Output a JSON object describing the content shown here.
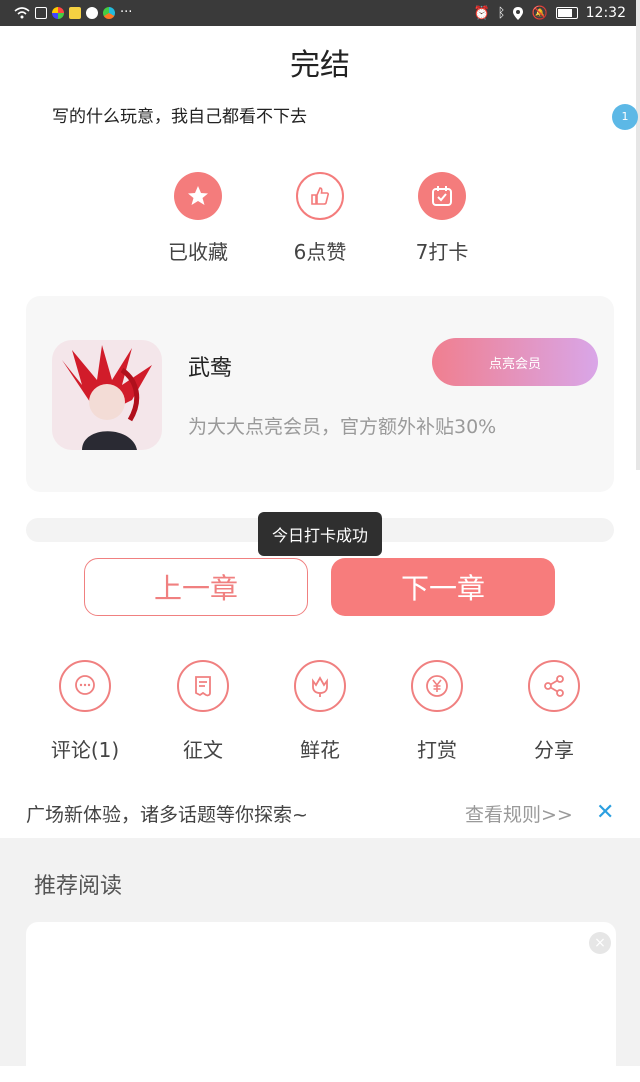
{
  "status_bar": {
    "time": "12:32",
    "left_icons": [
      "wifi-icon",
      "cloud-icon",
      "app-icon",
      "app-icon",
      "chat-icon",
      "app-icon"
    ],
    "more_indicator": "···"
  },
  "header": {
    "title": "完结"
  },
  "comment": {
    "text": "写的什么玩意，我自己都看不下去"
  },
  "notification_badge": {
    "count": "1"
  },
  "actions": {
    "collect_label": "已收藏",
    "like_label": "6点赞",
    "checkin_label": "7打卡"
  },
  "author_card": {
    "name": "武鸯",
    "member_button": "点亮会员",
    "subsidy_text": "为大大点亮会员，官方额外补贴30%"
  },
  "toast": {
    "text": "今日打卡成功"
  },
  "chapter_nav": {
    "prev_label": "上一章",
    "next_label": "下一章"
  },
  "tools": {
    "comment_label": "评论(1)",
    "essay_label": "征文",
    "flower_label": "鲜花",
    "reward_label": "打赏",
    "share_label": "分享"
  },
  "banner": {
    "text": "广场新体验，诸多话题等你探索~",
    "rules_link": "查看规则>>",
    "close_symbol": "✕"
  },
  "recommend": {
    "title": "推荐阅读",
    "close_symbol": "×"
  },
  "colors": {
    "accent": "#f47c7c",
    "badge": "#5cb8e6",
    "link_close": "#2b9fe0"
  }
}
